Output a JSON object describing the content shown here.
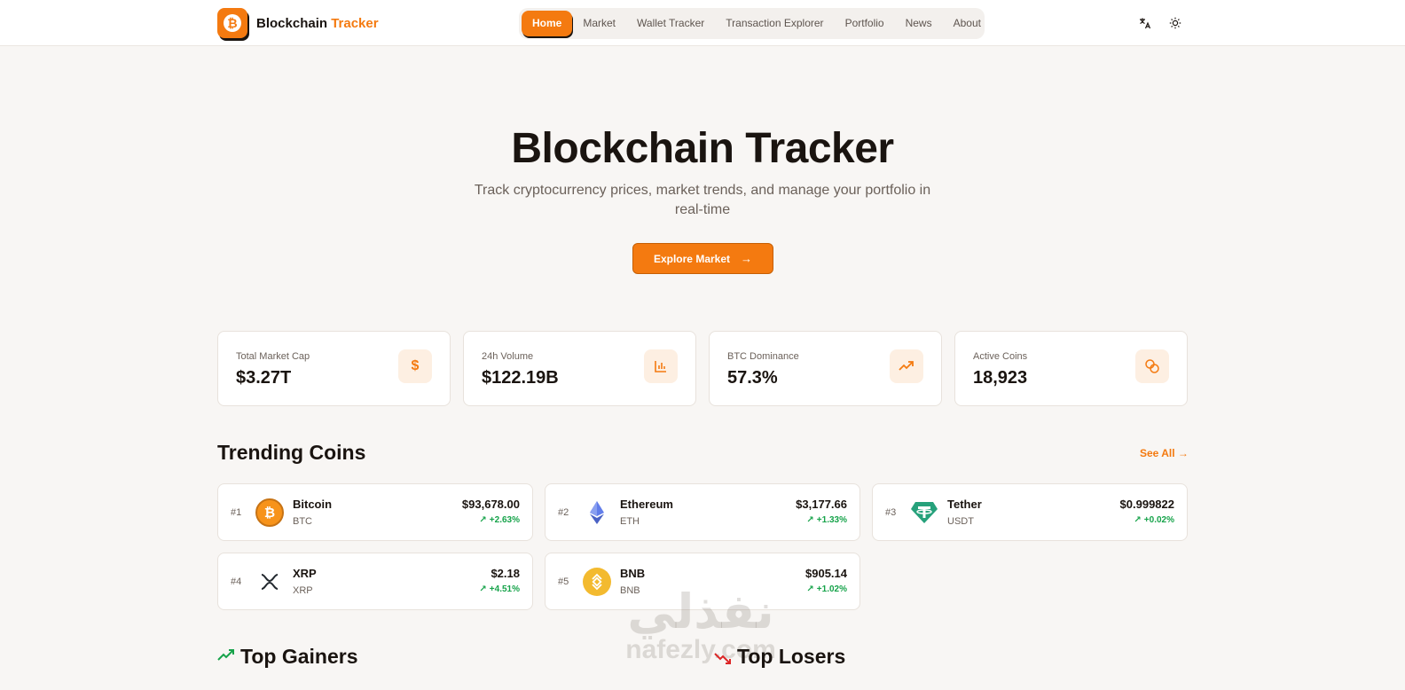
{
  "brand": {
    "name": "Blockchain",
    "accent": "Tracker",
    "logo_glyph": "₿",
    "color": "#f47a10"
  },
  "nav": [
    {
      "label": "Home",
      "active": true
    },
    {
      "label": "Market"
    },
    {
      "label": "Wallet Tracker"
    },
    {
      "label": "Transaction Explorer"
    },
    {
      "label": "Portfolio"
    },
    {
      "label": "News"
    },
    {
      "label": "About"
    }
  ],
  "header_icons": {
    "language": "translate-icon",
    "theme": "sun-icon"
  },
  "hero": {
    "title": "Blockchain Tracker",
    "subtitle": "Track cryptocurrency prices, market trends, and manage your portfolio in real-time",
    "cta": "Explore Market"
  },
  "stats": [
    {
      "label": "Total Market Cap",
      "value": "$3.27T",
      "icon": "dollar-icon"
    },
    {
      "label": "24h Volume",
      "value": "$122.19B",
      "icon": "bar-chart-icon"
    },
    {
      "label": "BTC Dominance",
      "value": "57.3%",
      "icon": "trending-up-icon"
    },
    {
      "label": "Active Coins",
      "value": "18,923",
      "icon": "coins-icon"
    }
  ],
  "trending": {
    "title": "Trending Coins",
    "see_all": "See All",
    "coins": [
      {
        "rank": "#1",
        "name": "Bitcoin",
        "symbol": "BTC",
        "price": "$93,678.00",
        "change": "+2.63%",
        "logo_color": "#f7931a"
      },
      {
        "rank": "#2",
        "name": "Ethereum",
        "symbol": "ETH",
        "price": "$3,177.66",
        "change": "+1.33%",
        "logo_color": "#627eea"
      },
      {
        "rank": "#3",
        "name": "Tether",
        "symbol": "USDT",
        "price": "$0.999822",
        "change": "+0.02%",
        "logo_color": "#26a17b"
      },
      {
        "rank": "#4",
        "name": "XRP",
        "symbol": "XRP",
        "price": "$2.18",
        "change": "+4.51%",
        "logo_color": "#23292f"
      },
      {
        "rank": "#5",
        "name": "BNB",
        "symbol": "BNB",
        "price": "$905.14",
        "change": "+1.02%",
        "logo_color": "#f3ba2f"
      }
    ]
  },
  "gainers": {
    "title": "Top Gainers"
  },
  "losers": {
    "title": "Top Losers"
  },
  "watermark": {
    "arabic": "نفذلي",
    "latin": "nafezly.com"
  },
  "colors": {
    "accent": "#f47a10",
    "positive": "#16a34a",
    "negative": "#dc2626",
    "background": "#f8f6f4"
  }
}
